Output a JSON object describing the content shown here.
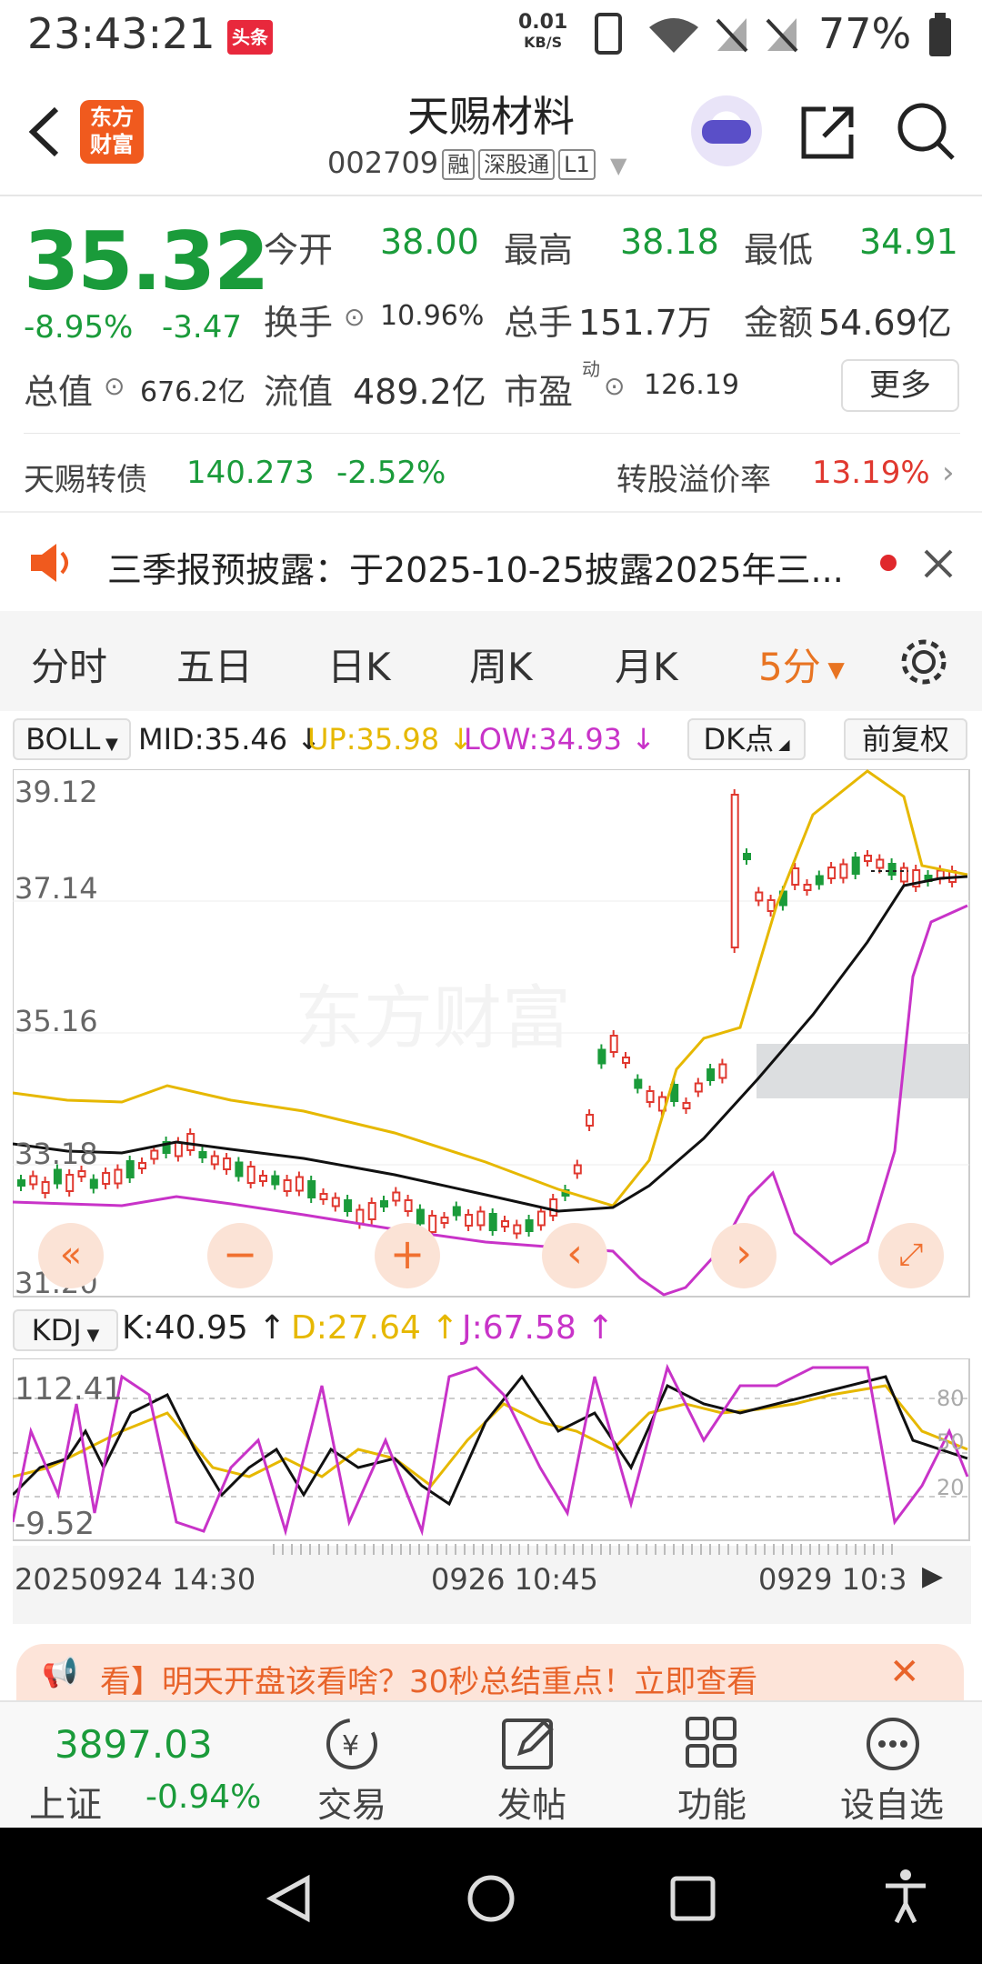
{
  "status_bar": {
    "time": "23:43:21",
    "app_badge_top": "头条",
    "net_speed_value": "0.01",
    "net_speed_unit": "KB/S",
    "battery_pct": "77%"
  },
  "header": {
    "logo_line1": "东方",
    "logo_line2": "财富",
    "stock_name": "天赐材料",
    "stock_code": "002709",
    "tags": [
      "融",
      "深股通",
      "L1"
    ]
  },
  "quote": {
    "price": "35.32",
    "change_pct": "-8.95%",
    "change_amt": "-3.47",
    "open_label": "今开",
    "open": "38.00",
    "high_label": "最高",
    "high": "38.18",
    "low_label": "最低",
    "low": "34.91",
    "turnover_label": "换手",
    "turnover": "10.96%",
    "volume_label": "总手",
    "volume": "151.7万",
    "amount_label": "金额",
    "amount": "54.69亿",
    "mktcap_label": "总值",
    "mktcap": "676.2亿",
    "float_label": "流值",
    "float": "489.2亿",
    "pe_label": "市盈",
    "pe_sup": "动",
    "pe": "126.19",
    "more_label": "更多"
  },
  "bond": {
    "name": "天赐转债",
    "price": "140.273",
    "change": "-2.52%",
    "premium_label": "转股溢价率",
    "premium": "13.19%"
  },
  "notice": {
    "text": "三季报预披露：于2025-10-25披露2025年三..."
  },
  "tabs": [
    {
      "label": "分时"
    },
    {
      "label": "五日"
    },
    {
      "label": "日K"
    },
    {
      "label": "周K"
    },
    {
      "label": "月K"
    },
    {
      "label": "5分"
    }
  ],
  "boll": {
    "name": "BOLL",
    "mid": "MID:35.46",
    "up": "UP:35.98",
    "low": "LOW:34.93",
    "dk_label": "DK点",
    "adjust_label": "前复权",
    "y_labels": [
      "39.12",
      "37.14",
      "35.16",
      "33.18",
      "31.20"
    ],
    "watermark": "东方财富"
  },
  "kdj": {
    "name": "KDJ",
    "k": "K:40.95",
    "d": "D:27.64",
    "j": "J:67.58",
    "y_top": "112.41",
    "y_bottom": "-9.52",
    "levels": [
      "80",
      "50",
      "20"
    ],
    "x_labels": [
      "20250924 14:30",
      "0926 10:45",
      "0929 10:3"
    ]
  },
  "ad": {
    "text": "看】明天开盘该看啥？30秒总结重点！立即查看"
  },
  "bottom_nav": {
    "index_value": "3897.03",
    "index_name": "上证",
    "index_change": "-0.94%",
    "items": [
      "交易",
      "发帖",
      "功能",
      "设自选"
    ]
  },
  "colors": {
    "up": "#e0382f",
    "down": "#1a9b3a",
    "accent": "#e87422",
    "boll_up": "#e6b800",
    "boll_low": "#c833c8",
    "mid": "#111111"
  }
}
